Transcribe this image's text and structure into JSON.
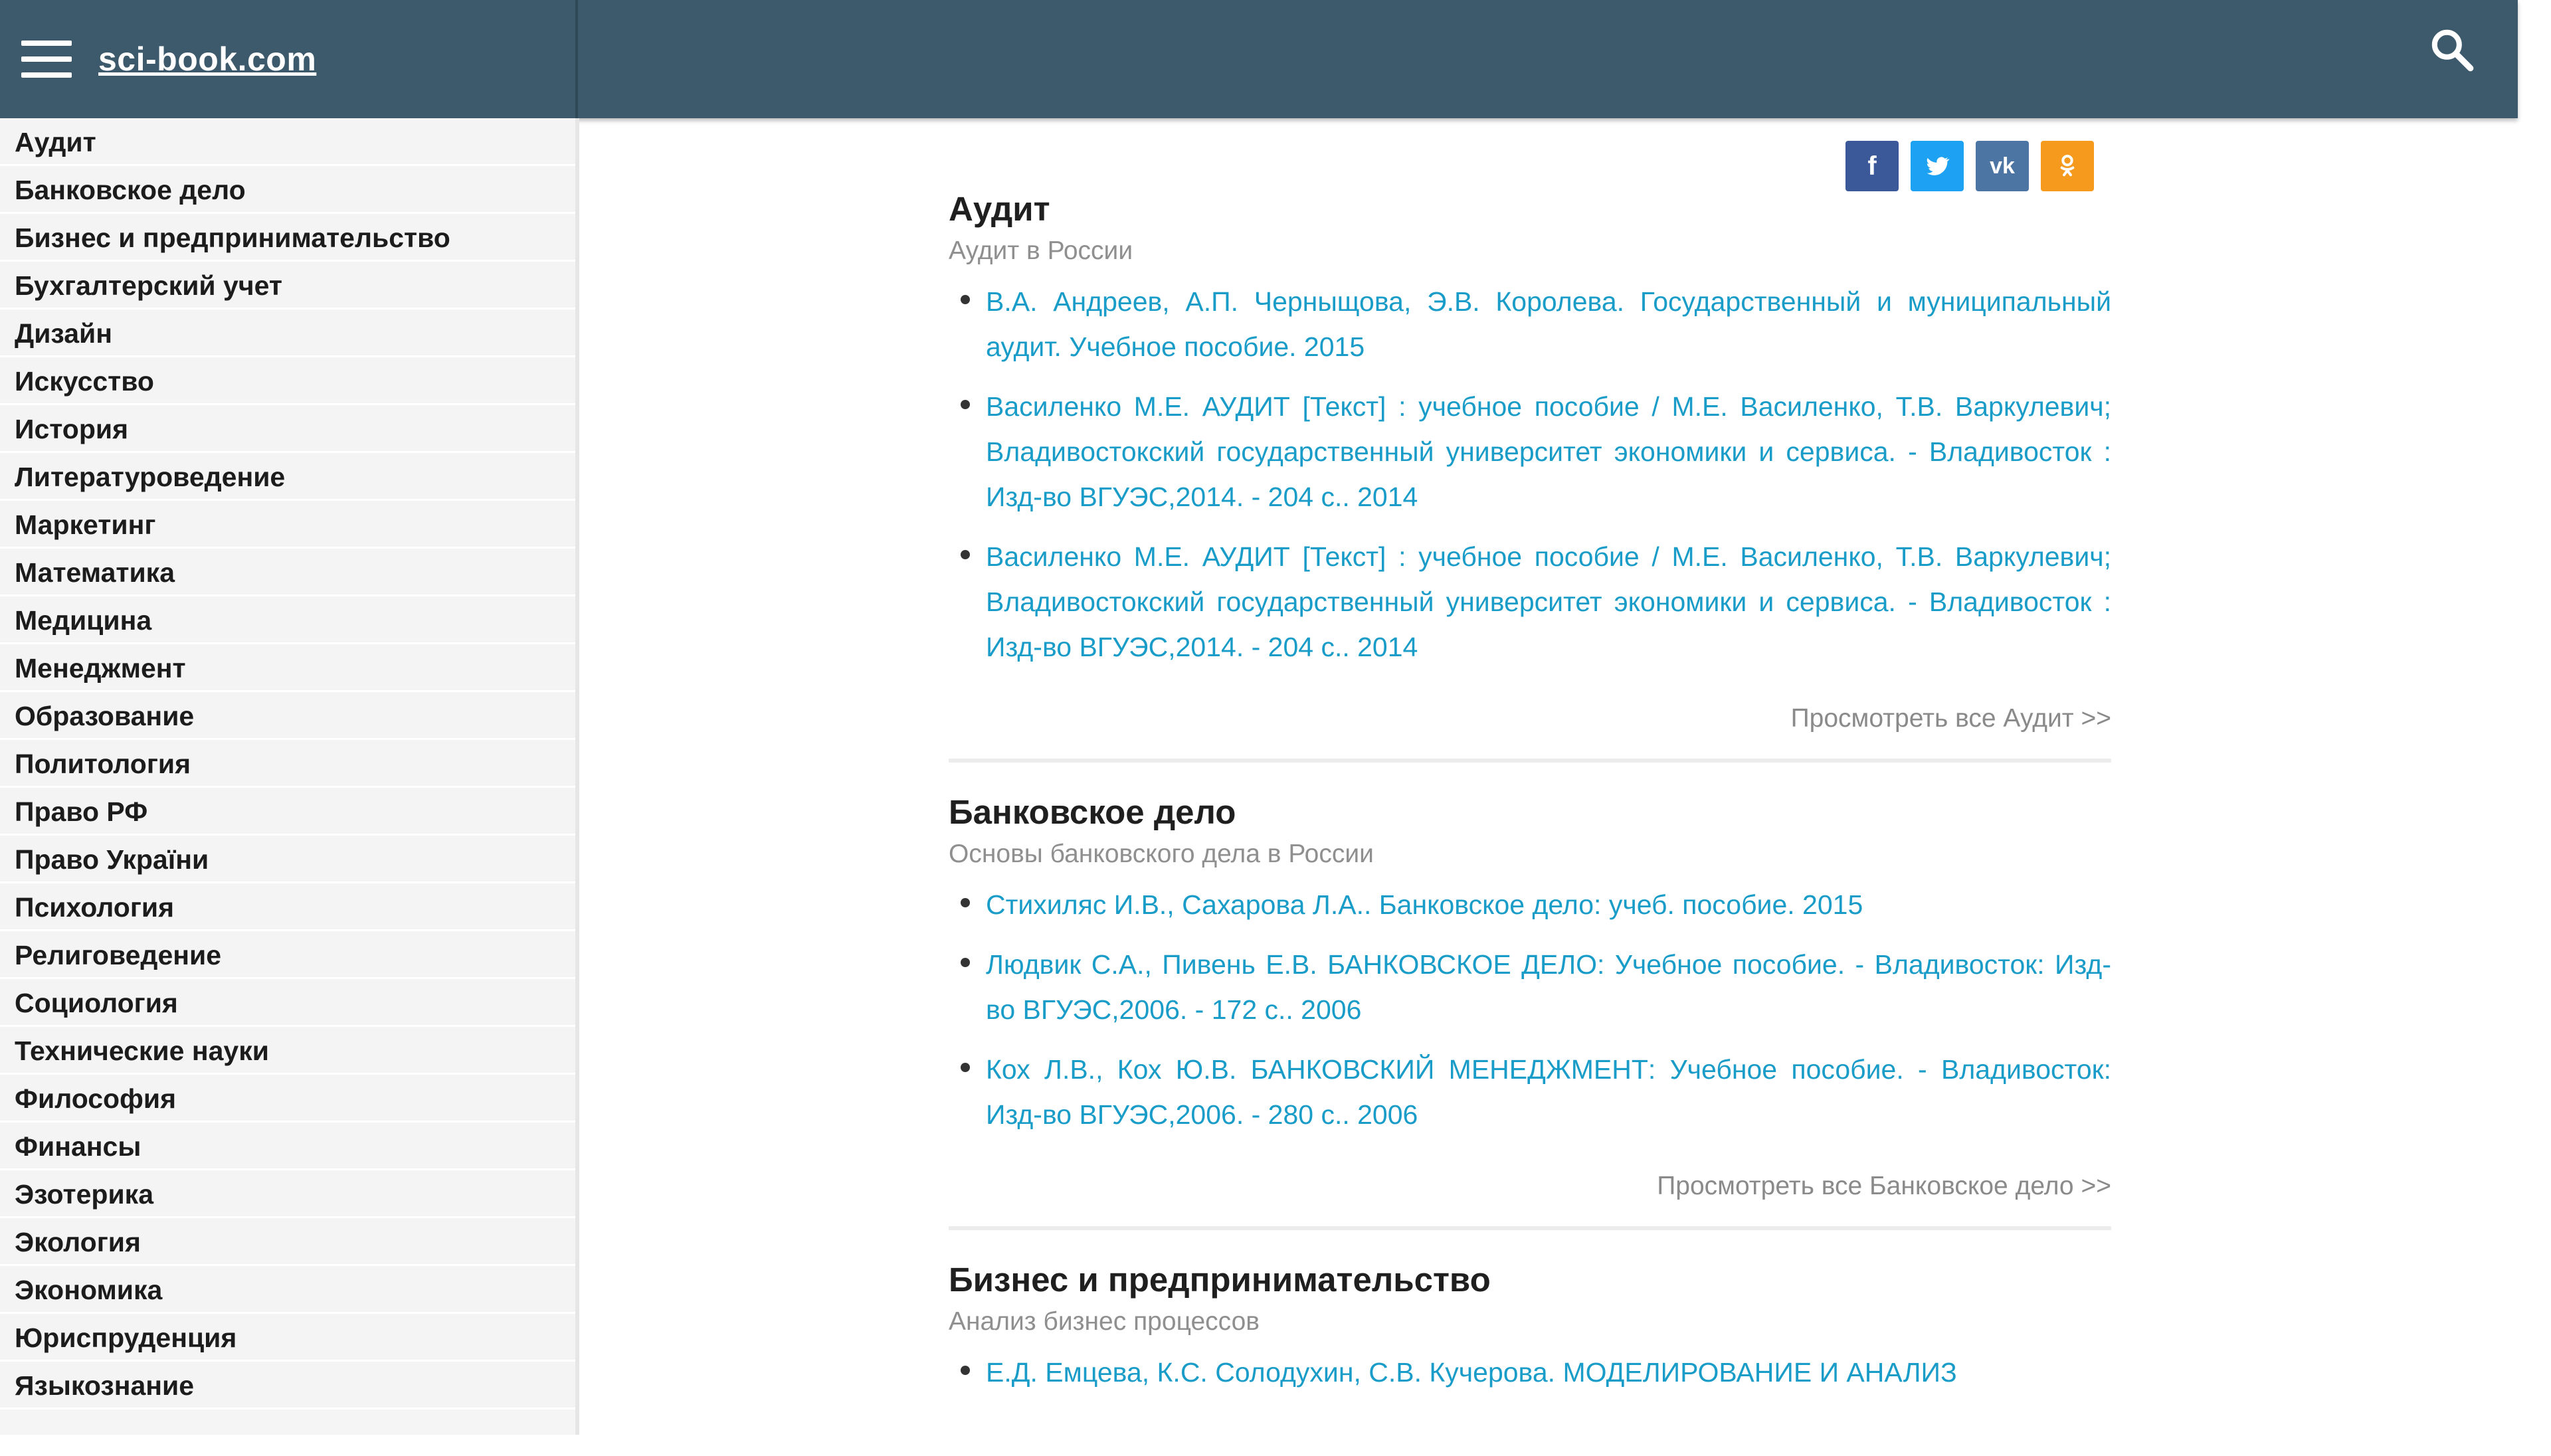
{
  "header": {
    "logo": "sci-book.com"
  },
  "sidebar": {
    "items": [
      "Аудит",
      "Банковское дело",
      "Бизнес и предпринимательство",
      "Бухгалтерский учет",
      "Дизайн",
      "Искусство",
      "История",
      "Литературоведение",
      "Маркетинг",
      "Математика",
      "Медицина",
      "Менеджмент",
      "Образование",
      "Политология",
      "Право РФ",
      "Право України",
      "Психология",
      "Религоведение",
      "Социология",
      "Технические науки",
      "Философия",
      "Финансы",
      "Эзотерика",
      "Экология",
      "Экономика",
      "Юриспруденция",
      "Языкознание"
    ]
  },
  "share": {
    "facebook": "f",
    "twitter": "t",
    "vk": "vk",
    "ok": "ok",
    "colors": {
      "facebook": "#3b5998",
      "twitter": "#1da1f2",
      "vk": "#4c75a3",
      "ok": "#f59a1d"
    }
  },
  "sections": [
    {
      "title": "Аудит",
      "subtitle": "Аудит в России",
      "items": [
        "В.А. Андреев, А.П. Черныщова, Э.В. Королева. Государственный и муниципальный аудит. Учебное пособие. 2015",
        "Василенко М.Е. АУДИТ [Текст] : учебное пособие / М.Е. Василенко, Т.В. Варкулевич; Владивостокский государственный университет экономики и сервиса. - Владивосток : Изд-во ВГУЭС,2014. - 204 с.. 2014",
        "Василенко М.Е. АУДИТ [Текст] : учебное пособие / М.Е. Василенко, Т.В. Варкулевич; Владивостокский государственный университет экономики и сервиса. - Владивосток : Изд-во ВГУЭС,2014. - 204 с.. 2014"
      ],
      "view_all": "Просмотреть все Аудит >>"
    },
    {
      "title": "Банковское дело",
      "subtitle": "Основы банковского дела в России",
      "items": [
        "Стихиляс И.В., Сахарова Л.А.. Банковское дело: учеб. пособие. 2015",
        "Людвик С.А., Пивень Е.В. БАНКОВСКОЕ ДЕЛО: Учебное пособие. - Владивосток: Изд-во ВГУЭС,2006. - 172 с.. 2006",
        "Кох Л.В., Кох Ю.В. БАНКОВСКИЙ МЕНЕДЖМЕНТ: Учебное пособие. - Владивосток: Изд-во ВГУЭС,2006. - 280 с.. 2006"
      ],
      "view_all": "Просмотреть все Банковское дело >>"
    },
    {
      "title": "Бизнес и предпринимательство",
      "subtitle": "Анализ бизнес процессов",
      "items": [
        "Е.Д. Емцева, К.С. Солодухин, С.В. Кучерова. МОДЕЛИРОВАНИЕ И АНАЛИЗ"
      ],
      "view_all": ""
    }
  ]
}
